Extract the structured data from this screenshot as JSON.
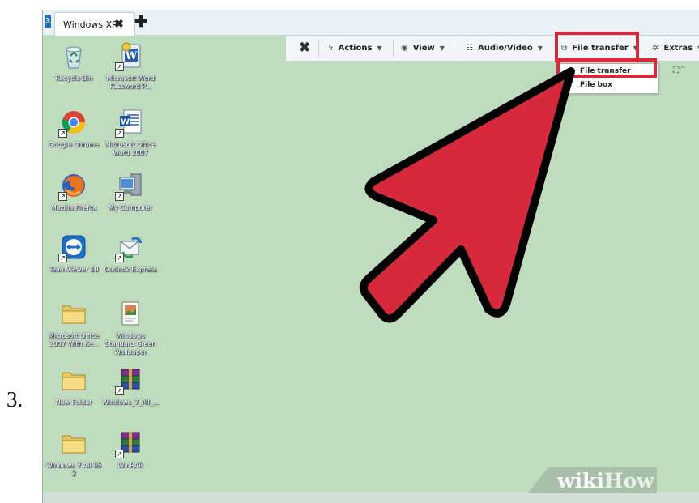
{
  "step_number": "3.",
  "tab": {
    "app_icon_glyph": "3",
    "title": "Windows XP",
    "close_glyph": "✖",
    "add_glyph": "✚"
  },
  "toolbar": {
    "close_glyph": "✖",
    "items": [
      {
        "label": "Actions",
        "icon": "lightning-icon",
        "glyph": "ϟ"
      },
      {
        "label": "View",
        "icon": "eye-icon",
        "glyph": "◉"
      },
      {
        "label": "Audio/Video",
        "icon": "chat-bubbles-icon",
        "glyph": "☷"
      },
      {
        "label": "File transfer",
        "icon": "files-icon",
        "glyph": "⧉"
      },
      {
        "label": "Extras",
        "icon": "tools-icon",
        "glyph": "✲"
      }
    ],
    "caret_glyph": "▼"
  },
  "dropdown": {
    "items": [
      "File transfer",
      "File box"
    ]
  },
  "small_icons": "⛶ ⌃",
  "desktop_icons": [
    {
      "label": "Recycle Bin",
      "icon": "recycle-bin-icon"
    },
    {
      "label": "Microsoft Word Password P...",
      "icon": "word-document-icon"
    },
    {
      "label": "Google Chrome",
      "icon": "chrome-icon"
    },
    {
      "label": "Microsoft Office Word 2007",
      "icon": "word-2007-icon"
    },
    {
      "label": "Mozilla Firefox",
      "icon": "firefox-icon"
    },
    {
      "label": "My Computer",
      "icon": "my-computer-icon"
    },
    {
      "label": "TeamViewer 10",
      "icon": "teamviewer-icon"
    },
    {
      "label": "Outlook Express",
      "icon": "outlook-express-icon"
    },
    {
      "label": "Microsoft Office 2007 With Ke...",
      "icon": "folder-icon"
    },
    {
      "label": "Windows Standard Green Wallpaper",
      "icon": "image-file-icon"
    },
    {
      "label": "New Folder",
      "icon": "folder-icon"
    },
    {
      "label": "Windows_7_All_...",
      "icon": "winrar-archive-icon"
    },
    {
      "label": "Windows 7 All 95 2",
      "icon": "folder-icon"
    },
    {
      "label": "WinRAR",
      "icon": "winrar-icon"
    }
  ],
  "watermark": {
    "wiki": "wiki",
    "how": "How"
  },
  "colors": {
    "desktop": "#bfdcbe",
    "highlight": "#d8283a",
    "arrow_fill": "#d62a3c",
    "arrow_outline": "#000000"
  }
}
